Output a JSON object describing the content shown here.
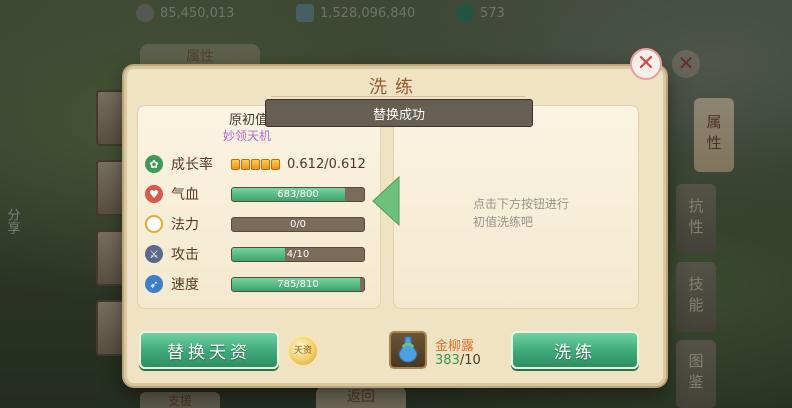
{
  "resources": {
    "silver": "85,450,013",
    "gems": "1,528,096,840",
    "jade": "573"
  },
  "background": {
    "side_tabs": [
      "属性",
      "抗性",
      "技能",
      "图鉴"
    ],
    "share": "分享",
    "top_tab": "属性",
    "bottom_tab_left": "支援",
    "bottom_tab_mid": "返回"
  },
  "dialog": {
    "title": "洗练",
    "toast": "替换成功",
    "original_label": "原初值",
    "pet_name": "妙领天机",
    "stats": [
      {
        "label": "成长率",
        "value": "0.612/0.612",
        "icon": "leaf-icon",
        "pips": 5
      },
      {
        "label": "气血",
        "value": "683/800",
        "current": 683,
        "max": 800,
        "icon": "heart-icon"
      },
      {
        "label": "法力",
        "value": "0/0",
        "current": 0,
        "max": 0,
        "icon": "mana-ring-icon"
      },
      {
        "label": "攻击",
        "value": "4/10",
        "current": 4,
        "max": 10,
        "icon": "sword-icon"
      },
      {
        "label": "速度",
        "value": "785/810",
        "current": 785,
        "max": 810,
        "icon": "boot-icon"
      }
    ],
    "hint_line1": "点击下方按钮进行",
    "hint_line2": "初值洗练吧",
    "replace_button": "替换天资",
    "wash_button": "洗练",
    "item_name": "金柳露",
    "item_have": "383",
    "item_need": "/10",
    "gold_badge": "天资"
  },
  "colors": {
    "accent_green": "#3ea879",
    "panel": "#efe3c4",
    "title_brown": "#9a5a2f"
  }
}
